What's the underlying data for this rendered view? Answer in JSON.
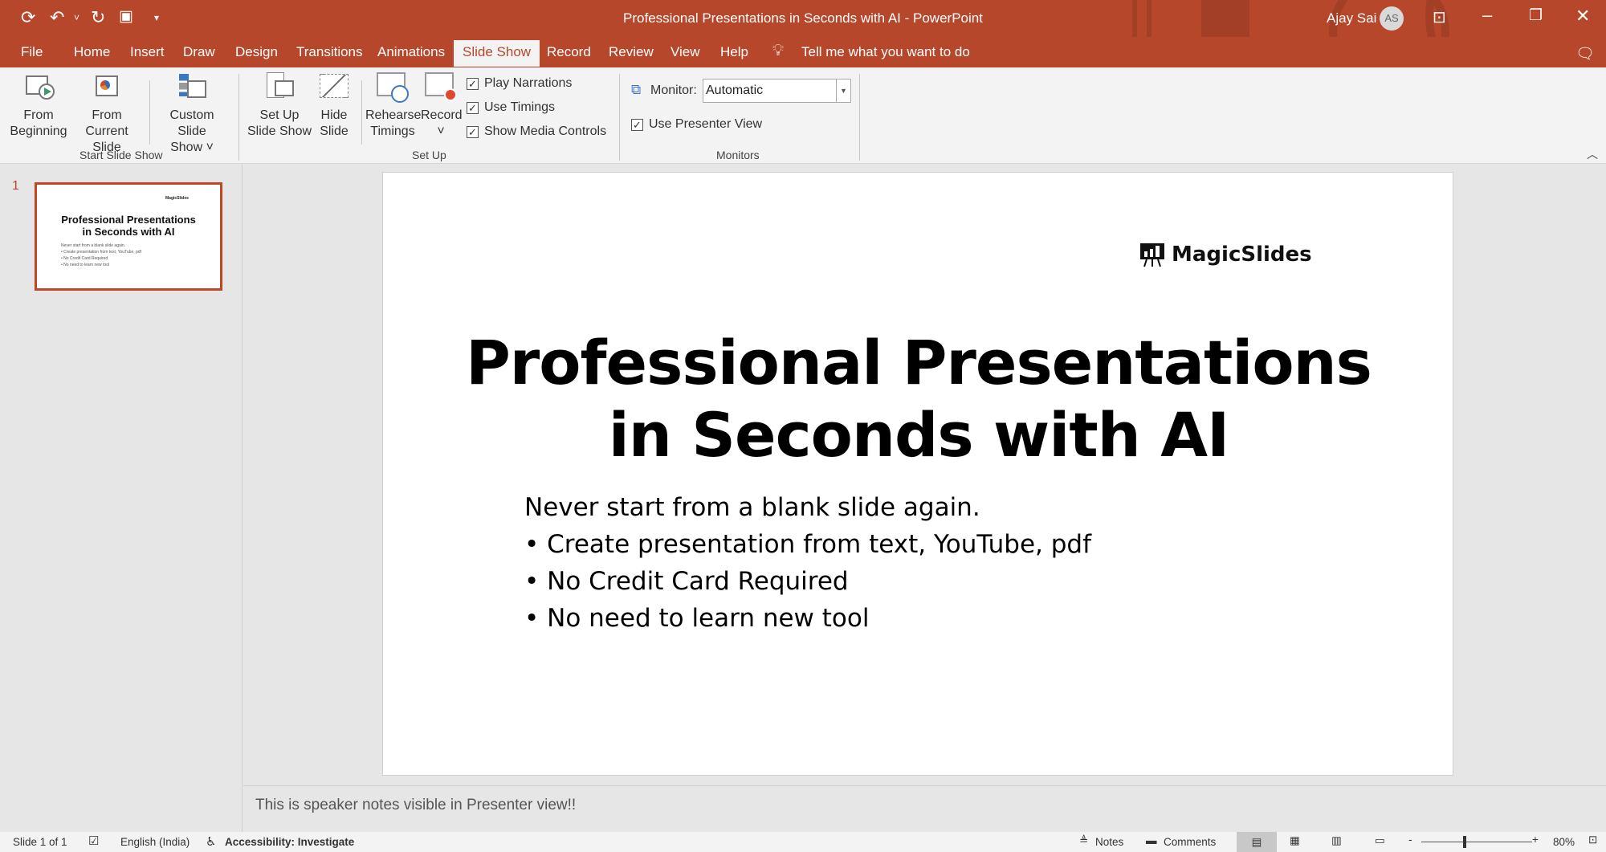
{
  "window": {
    "title": "Professional Presentations in Seconds with AI  -  PowerPoint",
    "user": "Ajay Sai",
    "avatar_initials": "AS",
    "accent": "#b7472a"
  },
  "qat": {
    "icons": [
      "autosave-icon",
      "undo-icon",
      "redo-icon",
      "present-icon",
      "customize-icon"
    ]
  },
  "tabs": [
    "File",
    "Home",
    "Insert",
    "Draw",
    "Design",
    "Transitions",
    "Animations",
    "Slide Show",
    "Record",
    "Review",
    "View",
    "Help"
  ],
  "active_tab": "Slide Show",
  "tell_me": "Tell me what you want to do",
  "ribbon": {
    "start": {
      "from_beginning": [
        "From",
        "Beginning"
      ],
      "from_current": [
        "From",
        "Current Slide"
      ],
      "custom": [
        "Custom Slide",
        "Show ˅"
      ],
      "label": "Start Slide Show"
    },
    "setup": {
      "setup_show": [
        "Set Up",
        "Slide Show"
      ],
      "hide": [
        "Hide",
        "Slide"
      ],
      "rehearse": [
        "Rehearse",
        "Timings"
      ],
      "record": [
        "Record",
        "˅"
      ],
      "play_narrations": "Play Narrations",
      "use_timings": "Use Timings",
      "show_media": "Show Media Controls",
      "label": "Set Up"
    },
    "monitors": {
      "monitor_label": "Monitor:",
      "monitor_value": "Automatic",
      "presenter_view": "Use Presenter View",
      "label": "Monitors"
    }
  },
  "slides_panel": {
    "number": "1"
  },
  "slide": {
    "logo": "MagicSlides",
    "title_lines": [
      "Professional Presentations",
      "in Seconds with AI"
    ],
    "body": [
      "Never start from a blank slide again.",
      "• Create presentation from text, YouTube, pdf",
      "• No Credit Card Required",
      "• No need to learn new tool"
    ]
  },
  "notes": "This is speaker notes visible in Presenter view!!",
  "status": {
    "slide": "Slide 1 of 1",
    "language": "English (India)",
    "accessibility": "Accessibility: Investigate",
    "notes": "Notes",
    "comments": "Comments",
    "zoom": "80%",
    "zoom_percent": 80
  }
}
